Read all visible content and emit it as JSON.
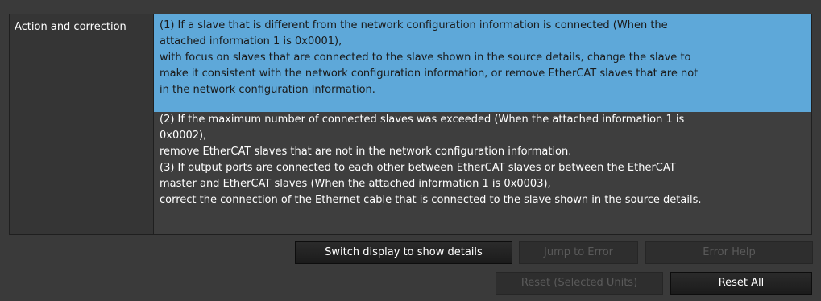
{
  "details": {
    "label": "Action and correction",
    "selected_lines": [
      "(1) If a slave that is different from the network configuration information is connected (When the",
      "attached information 1 is 0x0001),",
      "with focus on slaves that are connected to the slave shown in the source details, change the slave to",
      "make it consistent with the network configuration information, or remove EtherCAT slaves that are not",
      "in the network configuration information."
    ],
    "lines": [
      "(2) If the maximum number of connected slaves was exceeded (When the attached information 1 is",
      "0x0002),",
      "remove EtherCAT slaves that are not in the network configuration information.",
      "(3) If output ports are connected to each other between EtherCAT slaves or between the EtherCAT",
      "master and EtherCAT slaves (When the attached information 1 is 0x0003),",
      "correct the connection of the Ethernet cable that is connected to the slave shown in the source details."
    ]
  },
  "buttons": {
    "switch_display": "Switch display to show details",
    "jump_to_error": "Jump to Error",
    "error_help": "Error Help",
    "reset_selected": "Reset (Selected Units)",
    "reset_all": "Reset All"
  },
  "colors": {
    "panel_bg": "#3a3a3a",
    "selection": "#5ea8d9",
    "text": "#ffffff",
    "disabled_text": "#5a5a5a"
  }
}
